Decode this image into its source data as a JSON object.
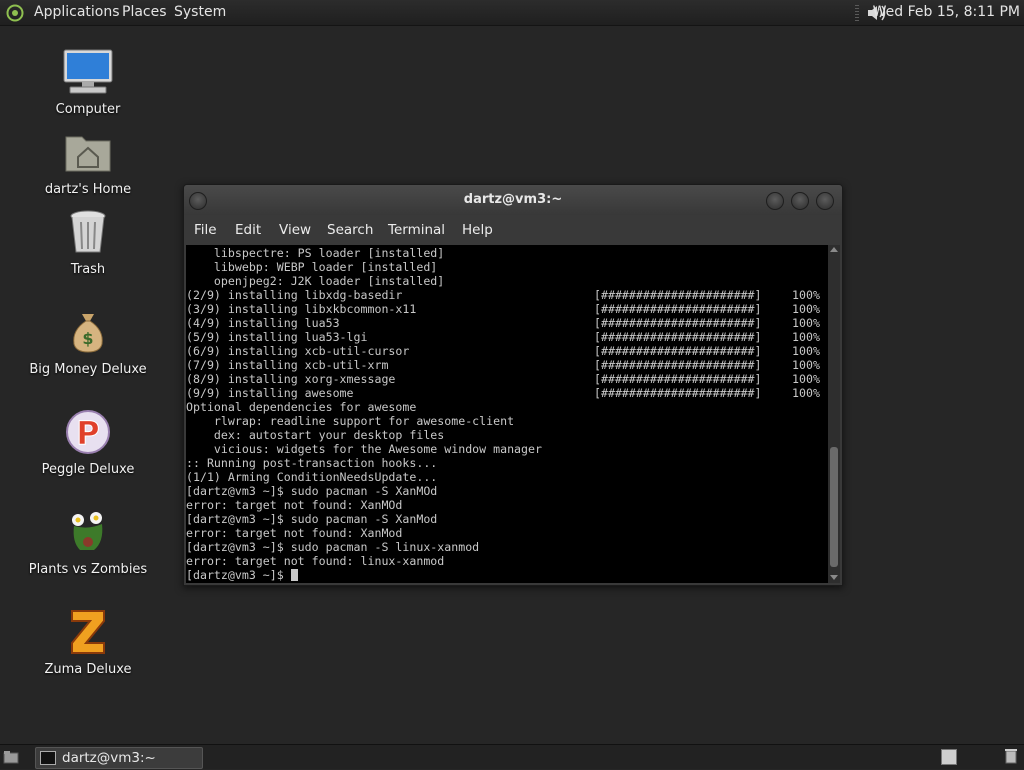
{
  "top_panel": {
    "menus": [
      "Applications",
      "Places",
      "System"
    ],
    "clock": "Wed Feb 15,  8:11 PM"
  },
  "desktop_icons": [
    {
      "label": "Computer",
      "icon": "computer-icon"
    },
    {
      "label": "dartz's Home",
      "icon": "home-folder-icon"
    },
    {
      "label": "Trash",
      "icon": "trash-icon"
    },
    {
      "label": "Big Money Deluxe",
      "icon": "money-bag-icon"
    },
    {
      "label": "Peggle Deluxe",
      "icon": "peggle-icon"
    },
    {
      "label": "Plants vs Zombies",
      "icon": "plants-vs-zombies-icon"
    },
    {
      "label": "Zuma Deluxe",
      "icon": "zuma-icon"
    }
  ],
  "terminal": {
    "title": "dartz@vm3:~",
    "menu": [
      "File",
      "Edit",
      "View",
      "Search",
      "Terminal",
      "Help"
    ],
    "lines": [
      "    libspectre: PS loader [installed]",
      "    libwebp: WEBP loader [installed]",
      "    openjpeg2: J2K loader [installed]",
      "(2/9) installing libxdg-basedir",
      "(3/9) installing libxkbcommon-x11",
      "(4/9) installing lua53",
      "(5/9) installing lua53-lgi",
      "(6/9) installing xcb-util-cursor",
      "(7/9) installing xcb-util-xrm",
      "(8/9) installing xorg-xmessage",
      "(9/9) installing awesome",
      "Optional dependencies for awesome",
      "    rlwrap: readline support for awesome-client",
      "    dex: autostart your desktop files",
      "    vicious: widgets for the Awesome window manager",
      ":: Running post-transaction hooks...",
      "(1/1) Arming ConditionNeedsUpdate...",
      "[dartz@vm3 ~]$ sudo pacman -S XanMOd",
      "error: target not found: XanMOd",
      "[dartz@vm3 ~]$ sudo pacman -S XanMod",
      "error: target not found: XanMod",
      "[dartz@vm3 ~]$ sudo pacman -S linux-xanmod",
      "error: target not found: linux-xanmod",
      "[dartz@vm3 ~]$ "
    ],
    "progress_bar": "[######################]",
    "progress_percent": "100%"
  },
  "taskbar": {
    "window_button": "dartz@vm3:~"
  }
}
